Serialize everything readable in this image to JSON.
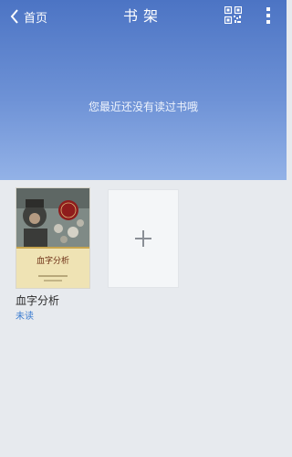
{
  "header": {
    "back_label": "首页",
    "title": "书架",
    "empty_message": "您最近还没有读过书哦"
  },
  "shelf": {
    "books": [
      {
        "title": "血字分析",
        "cover_title": "血字分析",
        "status": "未读"
      }
    ]
  },
  "icons": {
    "back": "chevron-left-icon",
    "qr": "qr-code-icon",
    "more": "more-vertical-icon",
    "add": "plus-icon"
  },
  "colors": {
    "header_top": "#4c74c4",
    "header_bottom": "#93b2e7",
    "background": "#e7eaee",
    "status_link": "#3a7bd0"
  }
}
